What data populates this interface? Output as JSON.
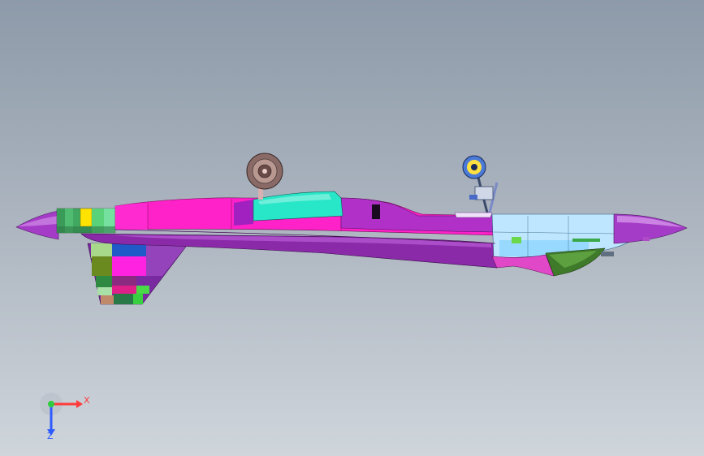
{
  "viewport": {
    "background_top": "#8d9aa9",
    "background_bottom": "#cfd5db"
  },
  "model": {
    "icon": "aircraft-model-icon",
    "colors": {
      "fuselage_magenta": "#ff22c8",
      "fuselage_purple": "#a020c0",
      "canopy_cyan": "#28e6c8",
      "nose_light_blue": "#bfe6ff",
      "nose_purple": "#a43cc8",
      "wing_violet": "#7a2aa0",
      "exhaust_yellow": "#ffe200",
      "radar_dish": "#8a6a66",
      "belly_green": "#3f7a2a"
    }
  },
  "triad": {
    "x_label": "X",
    "z_label": "Z",
    "x_color": "#ff3b3b",
    "y_color": "#2ecc40",
    "z_color": "#2d5bff"
  }
}
